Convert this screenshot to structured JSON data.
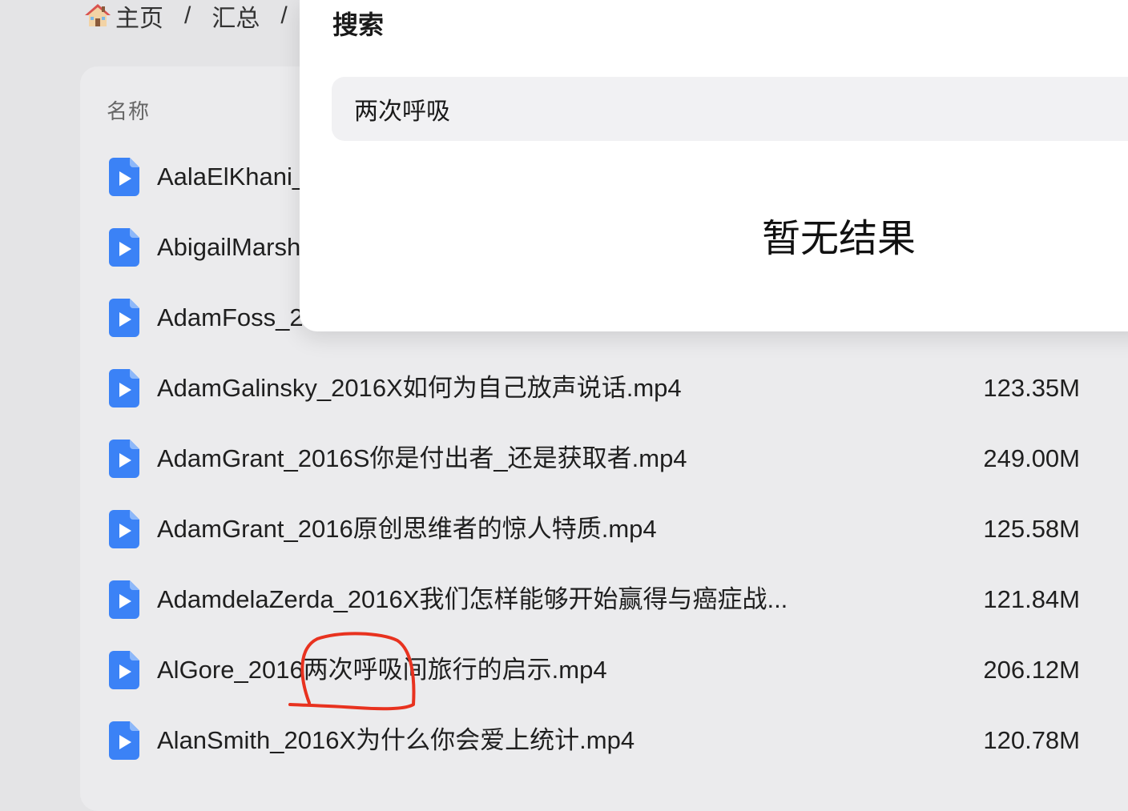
{
  "breadcrumb": {
    "home_icon": "house-icon",
    "home_label": "主页",
    "separator": "/",
    "summary_label": "汇总"
  },
  "file_list": {
    "column_name": "名称",
    "file_icon": "video-file-icon",
    "files": [
      {
        "name": "AalaElKhani_",
        "size": ""
      },
      {
        "name": "AbigailMarsh",
        "size": ""
      },
      {
        "name": "AdamFoss_2",
        "size": ""
      },
      {
        "name": "AdamGalinsky_2016X如何为自己放声说话.mp4",
        "size": "123.35M"
      },
      {
        "name": "AdamGrant_2016S你是付出者_还是获取者.mp4",
        "size": "249.00M"
      },
      {
        "name": "AdamGrant_2016原创思维者的惊人特质.mp4",
        "size": "125.58M"
      },
      {
        "name": "AdamdelaZerda_2016X我们怎样能够开始赢得与癌症战...",
        "size": "121.84M"
      },
      {
        "name": "AlGore_2016两次呼吸间旅行的启示.mp4",
        "size": "206.12M"
      },
      {
        "name": "AlanSmith_2016X为什么你会爱上统计.mp4",
        "size": "120.78M"
      }
    ]
  },
  "search": {
    "title": "搜索",
    "query": "两次呼吸",
    "empty_message": "暂无结果"
  },
  "colors": {
    "file_icon_blue": "#3b82f6",
    "annotation_red": "#e8321f",
    "background": "#e4e4e6",
    "card": "#ebebed",
    "panel": "#ffffff",
    "input_bg": "#f1f1f3"
  }
}
